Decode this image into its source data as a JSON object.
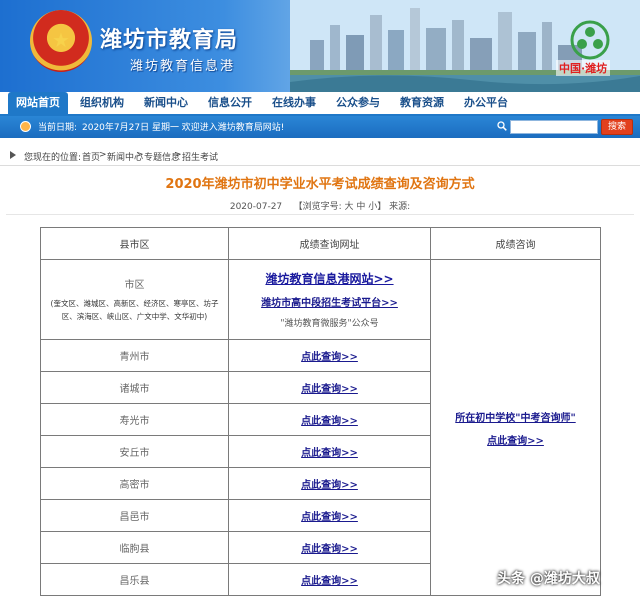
{
  "banner": {
    "title": "潍坊市教育局",
    "subtitle": "潍坊教育信息港",
    "logo_text": "中国·潍坊",
    "emblem_icon": "national-emblem-icon",
    "brand_color": "#1f78c8"
  },
  "nav": {
    "items": [
      {
        "label": "网站首页",
        "active": true
      },
      {
        "label": "组织机构"
      },
      {
        "label": "新闻中心"
      },
      {
        "label": "信息公开"
      },
      {
        "label": "在线办事"
      },
      {
        "label": "公众参与"
      },
      {
        "label": "教育资源"
      },
      {
        "label": "办公平台"
      }
    ]
  },
  "datebar": {
    "label": "当前日期:",
    "value": "2020年7月27日 星期一   欢迎进入潍坊教育局网站!",
    "search_placeholder": "",
    "search_button": "搜索"
  },
  "breadcrumb": {
    "prefix": "您现在的位置:",
    "items": [
      "首页",
      "新闻中心",
      "专题信息",
      "招生考试"
    ],
    "separator": ">"
  },
  "article": {
    "title": "2020年潍坊市初中学业水平考试成绩查询及咨询方式",
    "date": "2020-07-27",
    "font_size_label": "【浏览字号: 大 中 小】",
    "source_label": "来源:",
    "title_color": "#e07512"
  },
  "table": {
    "headers": [
      "县市区",
      "成绩查询网址",
      "成绩咨询"
    ],
    "first_row": {
      "city": "市区",
      "districts": "(奎文区、潍城区、高新区、经济区、寒亭区、坊子区、滨海区、峡山区、广文中学、文华初中)",
      "link_main": "潍坊教育信息港网站>>",
      "link_platform": "潍坊市高中段招生考试平台>>",
      "wechat": "\"潍坊教育微服务\"公众号"
    },
    "rows": [
      {
        "city": "青州市",
        "link": "点此查询>>"
      },
      {
        "city": "诸城市",
        "link": "点此查询>>"
      },
      {
        "city": "寿光市",
        "link": "点此查询>>"
      },
      {
        "city": "安丘市",
        "link": "点此查询>>"
      },
      {
        "city": "高密市",
        "link": "点此查询>>"
      },
      {
        "city": "昌邑市",
        "link": "点此查询>>"
      },
      {
        "city": "临朐县",
        "link": "点此查询>>"
      },
      {
        "city": "昌乐县",
        "link": "点此查询>>"
      }
    ],
    "consult": {
      "text": "所在初中学校\"中考咨询师\"",
      "link": "点此查询>>"
    }
  },
  "watermark": "头条 @潍坊大叔"
}
